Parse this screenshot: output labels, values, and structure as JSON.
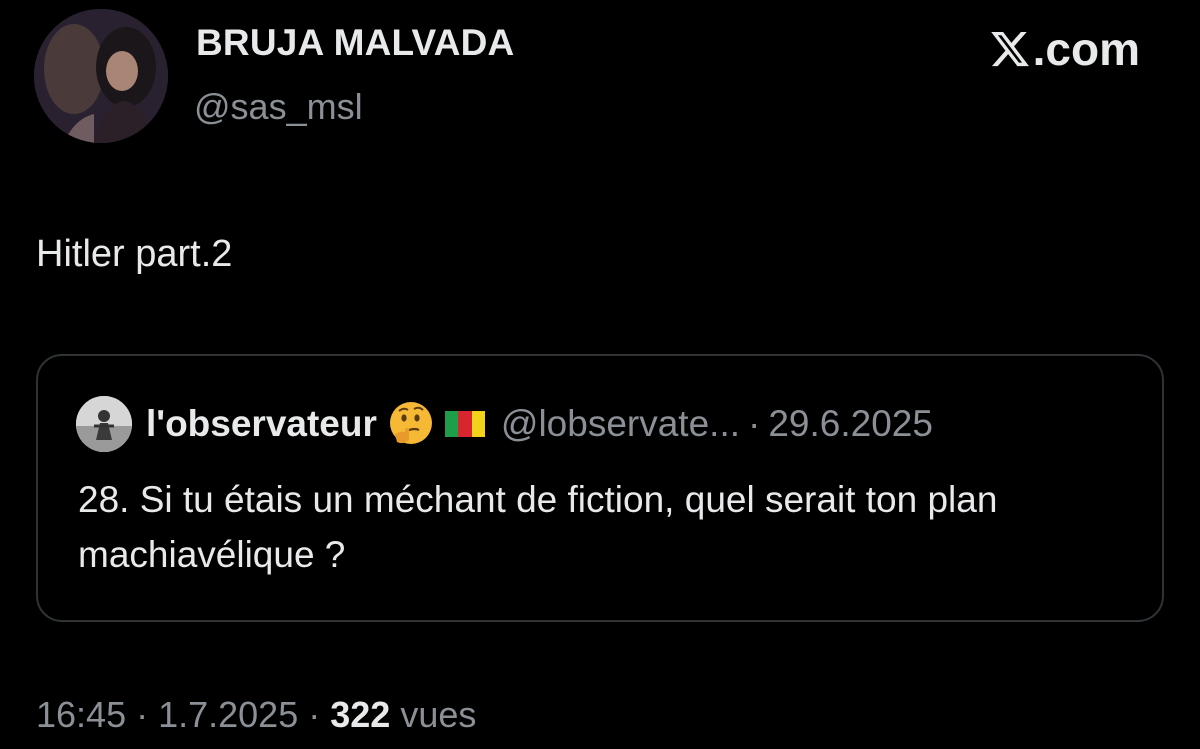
{
  "author": {
    "display_name": "BRUJA MALVADA",
    "handle": "@sas_msl"
  },
  "brand": {
    "label": ".com",
    "icon": "x-logo-icon"
  },
  "tweet": {
    "text": "Hitler part.2"
  },
  "quoted_tweet": {
    "display_name": "l'observateur",
    "emoji": "thinking-face-emoji",
    "flag": "cameroon-flag-icon",
    "handle": "@lobservate...",
    "separator": "·",
    "date": "29.6.2025",
    "text": "28. Si tu étais un méchant de fiction, quel serait ton plan machiavélique ?"
  },
  "meta": {
    "time": "16:45",
    "separator1": " · ",
    "date": "1.7.2025",
    "separator2": " · ",
    "views_count": "322",
    "views_label": " vues"
  },
  "colors": {
    "background": "#000000",
    "primary_text": "#e7e9ea",
    "secondary_text": "#8b9096",
    "card_border": "#2f3336"
  }
}
